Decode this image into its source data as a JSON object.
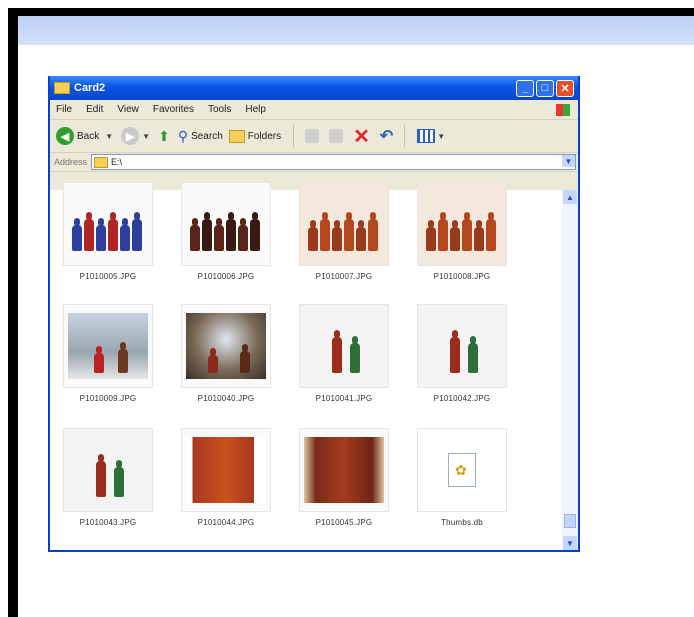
{
  "window": {
    "title": "Card2",
    "min_glyph": "_",
    "max_glyph": "□",
    "close_glyph": "✕"
  },
  "menu": [
    "File",
    "Edit",
    "View",
    "Favorites",
    "Tools",
    "Help"
  ],
  "toolbar": {
    "back_label": "Back",
    "search_label": "Search",
    "folders_label": "Folders"
  },
  "address": {
    "label": "Address",
    "value": "E:\\"
  },
  "files": [
    {
      "name": "P1010005.JPG",
      "kind": "figures-blue"
    },
    {
      "name": "P1010006.JPG",
      "kind": "figures-dark"
    },
    {
      "name": "P1010007.JPG",
      "kind": "figures-red"
    },
    {
      "name": "P1010008.JPG",
      "kind": "figures-red"
    },
    {
      "name": "P1010009.JPG",
      "kind": "scene-light"
    },
    {
      "name": "P1010040.JPG",
      "kind": "scene-dark"
    },
    {
      "name": "P1010041.JPG",
      "kind": "calls"
    },
    {
      "name": "P1010042.JPG",
      "kind": "calls"
    },
    {
      "name": "P1010043.JPG",
      "kind": "calls"
    },
    {
      "name": "P1010044.JPG",
      "kind": "wood"
    },
    {
      "name": "P1010045.JPG",
      "kind": "wood-dark"
    },
    {
      "name": "Thumbs.db",
      "kind": "file"
    }
  ],
  "colors": {
    "titlebar": "#0a55e6",
    "accent_blue": "#bcd0f5"
  }
}
